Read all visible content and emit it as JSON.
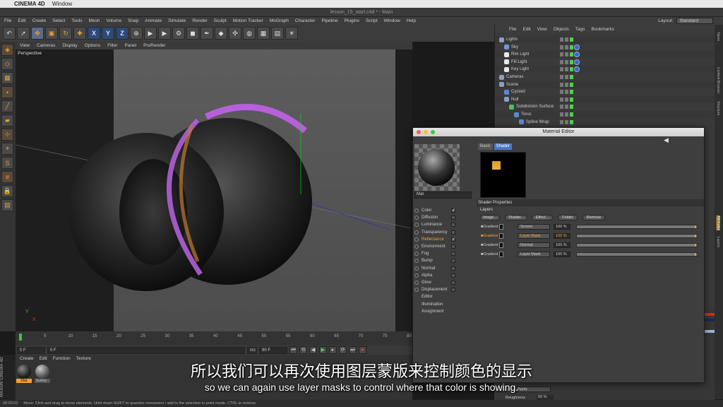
{
  "mac_menu": {
    "app": "CINEMA 4D",
    "window": "Window"
  },
  "window_title": "lesson_15_start.c4d * - Main",
  "main_menu": [
    "File",
    "Edit",
    "Create",
    "Select",
    "Tools",
    "Mesh",
    "Volume",
    "Snap",
    "Animate",
    "Simulate",
    "Render",
    "Sculpt",
    "Motion Tracker",
    "MoGraph",
    "Character",
    "Pipeline",
    "Plugins",
    "Script",
    "Window",
    "Help"
  ],
  "layout": {
    "label": "Layout:",
    "value": "Standard"
  },
  "toolbar": [
    "undo",
    "select",
    "move",
    "scale",
    "rotate",
    "add",
    "X",
    "Y",
    "Z",
    "coord",
    "render-view",
    "render",
    "render-settings",
    "cube",
    "pen",
    "subdiv",
    "cloner",
    "deformer",
    "floor",
    "camera",
    "light"
  ],
  "view_menu": [
    "View",
    "Cameras",
    "Display",
    "Options",
    "Filter",
    "Panel",
    "ProRender"
  ],
  "viewport_label": "Perspective",
  "timeline": {
    "ticks": [
      "0",
      "5",
      "10",
      "15",
      "20",
      "25",
      "30",
      "35",
      "40",
      "45",
      "50",
      "55",
      "60",
      "65",
      "70",
      "75",
      "80"
    ]
  },
  "transport": {
    "start": "0 F",
    "current": "0 F",
    "end_a": "90 F",
    "end_b": "90 F",
    "mid": "601"
  },
  "material_manager": {
    "menu": [
      "Create",
      "Edit",
      "Function",
      "Texture"
    ],
    "materials": [
      {
        "name": "Mat",
        "active": true
      },
      {
        "name": "Sunny -",
        "active": false
      }
    ]
  },
  "status": {
    "time": "00:00:02",
    "text": "Move: Click and drag to move elements. Hold down SHIFT to quantize movement / add to the selection in point mode, CTRL to remove."
  },
  "object_manager": {
    "menu": [
      "File",
      "Edit",
      "View",
      "Objects",
      "Tags",
      "Bookmarks"
    ],
    "rows": [
      {
        "name": "Lights",
        "color": "#8aa0c0",
        "indent": 0
      },
      {
        "name": "Sky",
        "color": "#6a9ad8",
        "indent": 1
      },
      {
        "name": "Rim Light",
        "color": "#e8e8e8",
        "indent": 1
      },
      {
        "name": "Fill Light",
        "color": "#e8e8e8",
        "indent": 1
      },
      {
        "name": "Key Light",
        "color": "#e8e8e8",
        "indent": 1
      },
      {
        "name": "Cameras",
        "color": "#8aa0c0",
        "indent": 0
      },
      {
        "name": "Scene",
        "color": "#8aa0c0",
        "indent": 0
      },
      {
        "name": "Cycloid",
        "color": "#5a8ad0",
        "indent": 1
      },
      {
        "name": "Null",
        "color": "#8aa0c0",
        "indent": 1
      },
      {
        "name": "Subdivision Surface",
        "color": "#4ac060",
        "indent": 2
      },
      {
        "name": "Torus",
        "color": "#5a8ad0",
        "indent": 3
      },
      {
        "name": "Spline Wrap",
        "color": "#5a8ad0",
        "indent": 4
      }
    ]
  },
  "right_strip": [
    "Takes",
    "Content Browser",
    "Structure",
    "Attributes",
    "Layers"
  ],
  "material_editor": {
    "title": "Material Editor",
    "mat_name": "Mat",
    "tabs": [
      "Basic",
      "Shader"
    ],
    "active_tab": "Shader",
    "channels": [
      {
        "name": "Color",
        "checked": true
      },
      {
        "name": "Diffusion",
        "checked": false
      },
      {
        "name": "Luminance",
        "checked": false
      },
      {
        "name": "Transparency",
        "checked": false
      },
      {
        "name": "Reflectance",
        "checked": true,
        "active": true
      },
      {
        "name": "Environment",
        "checked": false
      },
      {
        "name": "Fog",
        "checked": false
      },
      {
        "name": "Bump",
        "checked": false
      },
      {
        "name": "Normal",
        "checked": false
      },
      {
        "name": "Alpha",
        "checked": false
      },
      {
        "name": "Glow",
        "checked": false
      },
      {
        "name": "Displacement",
        "checked": false
      },
      {
        "name": "Editor",
        "checked": null
      },
      {
        "name": "Illumination",
        "checked": null
      },
      {
        "name": "Assignment",
        "checked": null
      }
    ],
    "section": "Shader Properties",
    "layers_label": "Layers",
    "buttons": [
      "Image...",
      "Shader...",
      "Effect...",
      "Folder",
      "Remove"
    ],
    "layers": [
      {
        "name": "Gradient",
        "mode": "Screen",
        "pct": "100 %"
      },
      {
        "name": "Gradient",
        "mode": "Layer Mask",
        "pct": "100 %",
        "active": true
      },
      {
        "name": "Gradient",
        "mode": "Normal",
        "pct": "100 %"
      },
      {
        "name": "Gradient",
        "mode": "Layer Mask",
        "pct": "100 %"
      }
    ]
  },
  "attr_lower": {
    "apply": "Apply",
    "roughness_label": "Roughness",
    "roughness_value": "50 %"
  },
  "subtitles": {
    "zh": "所以我们可以再次使用图层蒙版来控制颜色的显示",
    "en": "so we can again use layer masks to control where that color is showing."
  },
  "brand": "MAXON CINEMA 4D"
}
